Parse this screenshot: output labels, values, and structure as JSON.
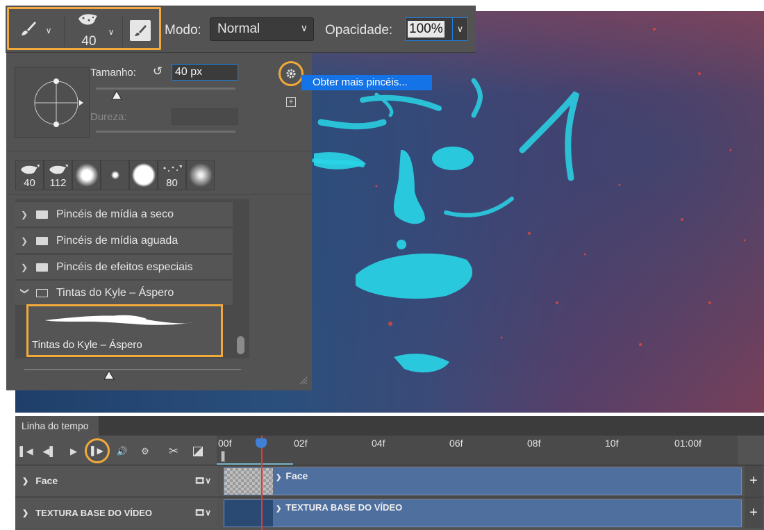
{
  "options_bar": {
    "brush_size_label": "40",
    "mode_label": "Modo:",
    "mode_value": "Normal",
    "opacity_label": "Opacidade:",
    "opacity_value": "100%"
  },
  "brush_panel": {
    "size_label": "Tamanho:",
    "size_value": "40 px",
    "hardness_label": "Dureza:",
    "tooltip": "Obter mais pincéis...",
    "presets": [
      {
        "icon": "rough-brush-icon",
        "num": "40"
      },
      {
        "icon": "rough-brush-icon",
        "num": "112"
      },
      {
        "icon": "soft-round-brush-icon",
        "num": ""
      },
      {
        "icon": "small-round-brush-icon",
        "num": ""
      },
      {
        "icon": "hard-round-brush-icon",
        "num": ""
      },
      {
        "icon": "scatter-brush-icon",
        "num": "80"
      },
      {
        "icon": "soft-round-brush-icon",
        "num": ""
      }
    ],
    "folders": [
      {
        "label": "Pincéis de mídia a seco",
        "open": false
      },
      {
        "label": "Pincéis de mídia aguada",
        "open": false
      },
      {
        "label": "Pincéis de efeitos especiais",
        "open": false
      },
      {
        "label": "Tintas do Kyle – Áspero",
        "open": true
      }
    ],
    "selected_brush": "Tintas do Kyle – Áspero"
  },
  "timeline": {
    "tab_label": "Linha do tempo",
    "ruler": [
      "00f",
      "02f",
      "04f",
      "06f",
      "08f",
      "10f",
      "01:00f"
    ],
    "tracks": [
      {
        "name": "Face",
        "clip": "Face"
      },
      {
        "name": "TEXTURA BASE DO VÍDEO",
        "clip": "TEXTURA BASE DO VÍDEO"
      }
    ]
  },
  "colors": {
    "highlight": "#f2a93b",
    "accent": "#1473e6",
    "panel": "#535353",
    "glow": "#29d6e8"
  }
}
